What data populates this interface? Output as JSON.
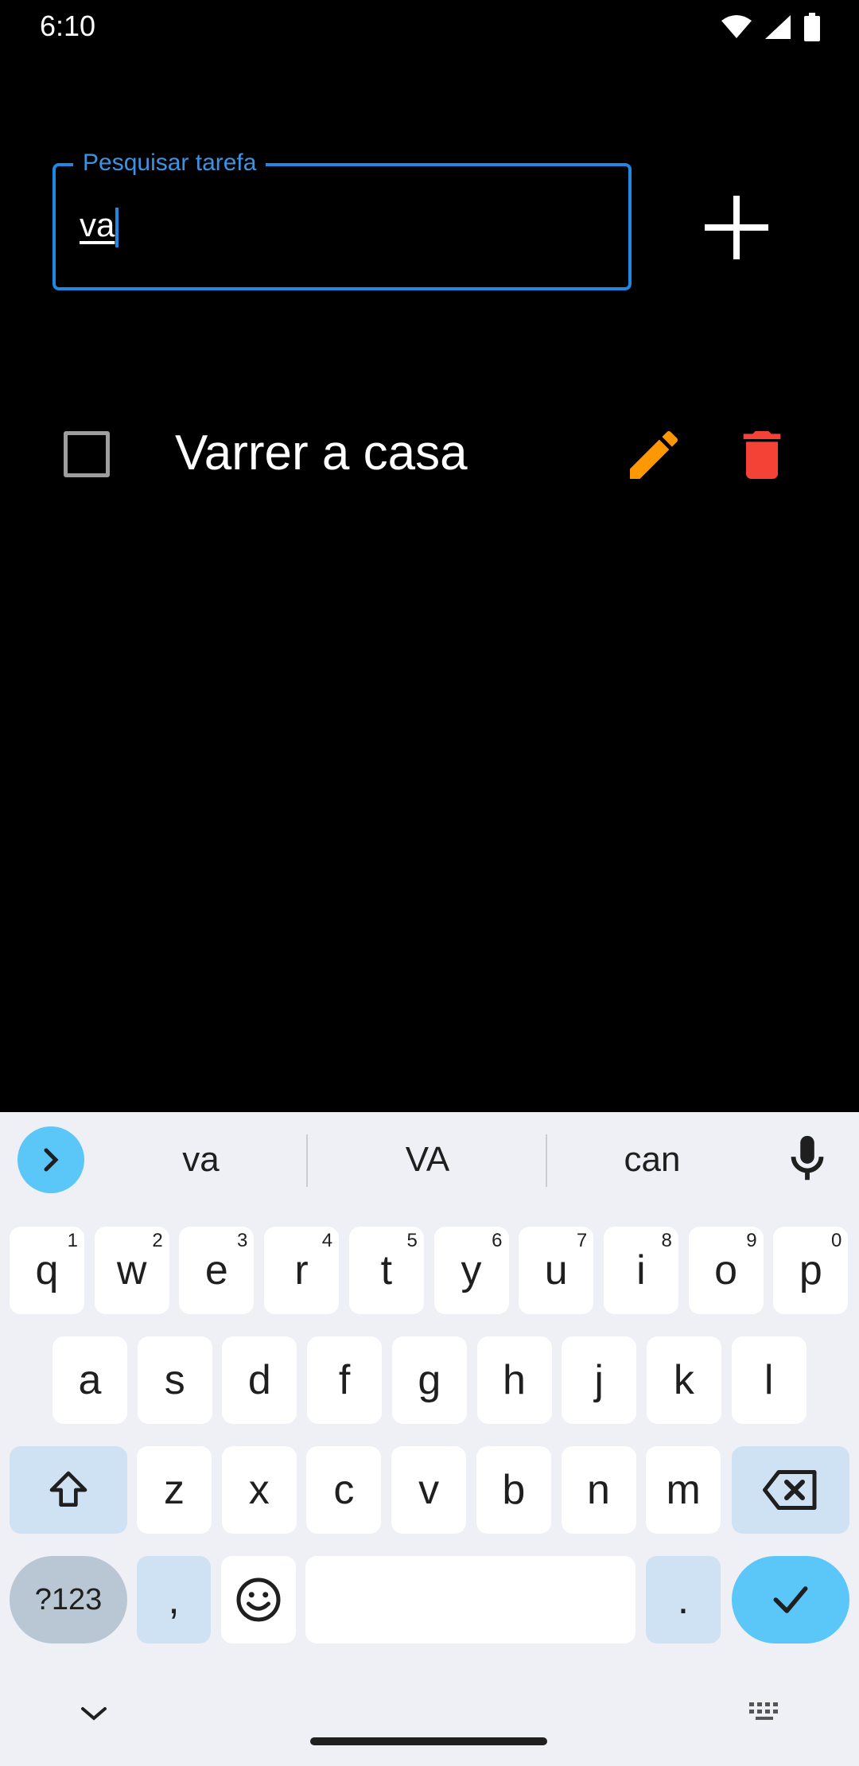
{
  "status_bar": {
    "time": "6:10",
    "icons": [
      "wifi-icon",
      "signal-icon",
      "battery-icon"
    ]
  },
  "search": {
    "label": "Pesquisar tarefa",
    "value": "va",
    "accent": "#1e88e5"
  },
  "add_button": {
    "icon": "plus-icon"
  },
  "tasks": [
    {
      "text": "Varrer a casa",
      "checked": false,
      "edit_color": "#ff9800",
      "delete_color": "#f44336"
    }
  ],
  "keyboard": {
    "suggestions": [
      "va",
      "VA",
      "can"
    ],
    "row1": [
      {
        "k": "q",
        "h": "1"
      },
      {
        "k": "w",
        "h": "2"
      },
      {
        "k": "e",
        "h": "3"
      },
      {
        "k": "r",
        "h": "4"
      },
      {
        "k": "t",
        "h": "5"
      },
      {
        "k": "y",
        "h": "6"
      },
      {
        "k": "u",
        "h": "7"
      },
      {
        "k": "i",
        "h": "8"
      },
      {
        "k": "o",
        "h": "9"
      },
      {
        "k": "p",
        "h": "0"
      }
    ],
    "row2": [
      "a",
      "s",
      "d",
      "f",
      "g",
      "h",
      "j",
      "k",
      "l"
    ],
    "row3": [
      "z",
      "x",
      "c",
      "v",
      "b",
      "n",
      "m"
    ],
    "symbols_label": "?123",
    "comma": ",",
    "period": "."
  }
}
